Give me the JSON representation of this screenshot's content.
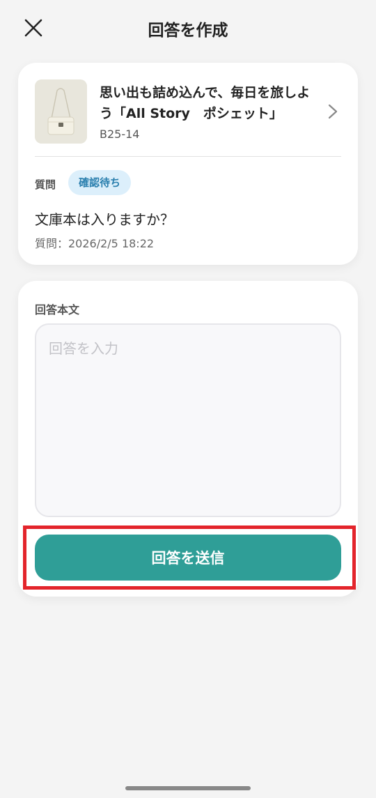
{
  "header": {
    "title": "回答を作成",
    "close_icon": "close-icon"
  },
  "product": {
    "name": "思い出も詰め込んで、毎日を旅しよう「All Story　ポシェット」",
    "code": "B25-14",
    "thumb_icon": "product-bag-image",
    "chevron_icon": "chevron-right-icon"
  },
  "question": {
    "label": "質問",
    "status": "確認待ち",
    "text": "文庫本は入りますか？",
    "date": "質問：2026/2/5 18:22"
  },
  "answer": {
    "label": "回答本文",
    "placeholder": "回答を入力",
    "value": "",
    "submit_label": "回答を送信"
  },
  "colors": {
    "accent": "#2f9e97",
    "badge_bg": "#dceffb",
    "badge_text": "#2a7fae",
    "highlight": "#e3242b",
    "background": "#f4f4f4"
  }
}
